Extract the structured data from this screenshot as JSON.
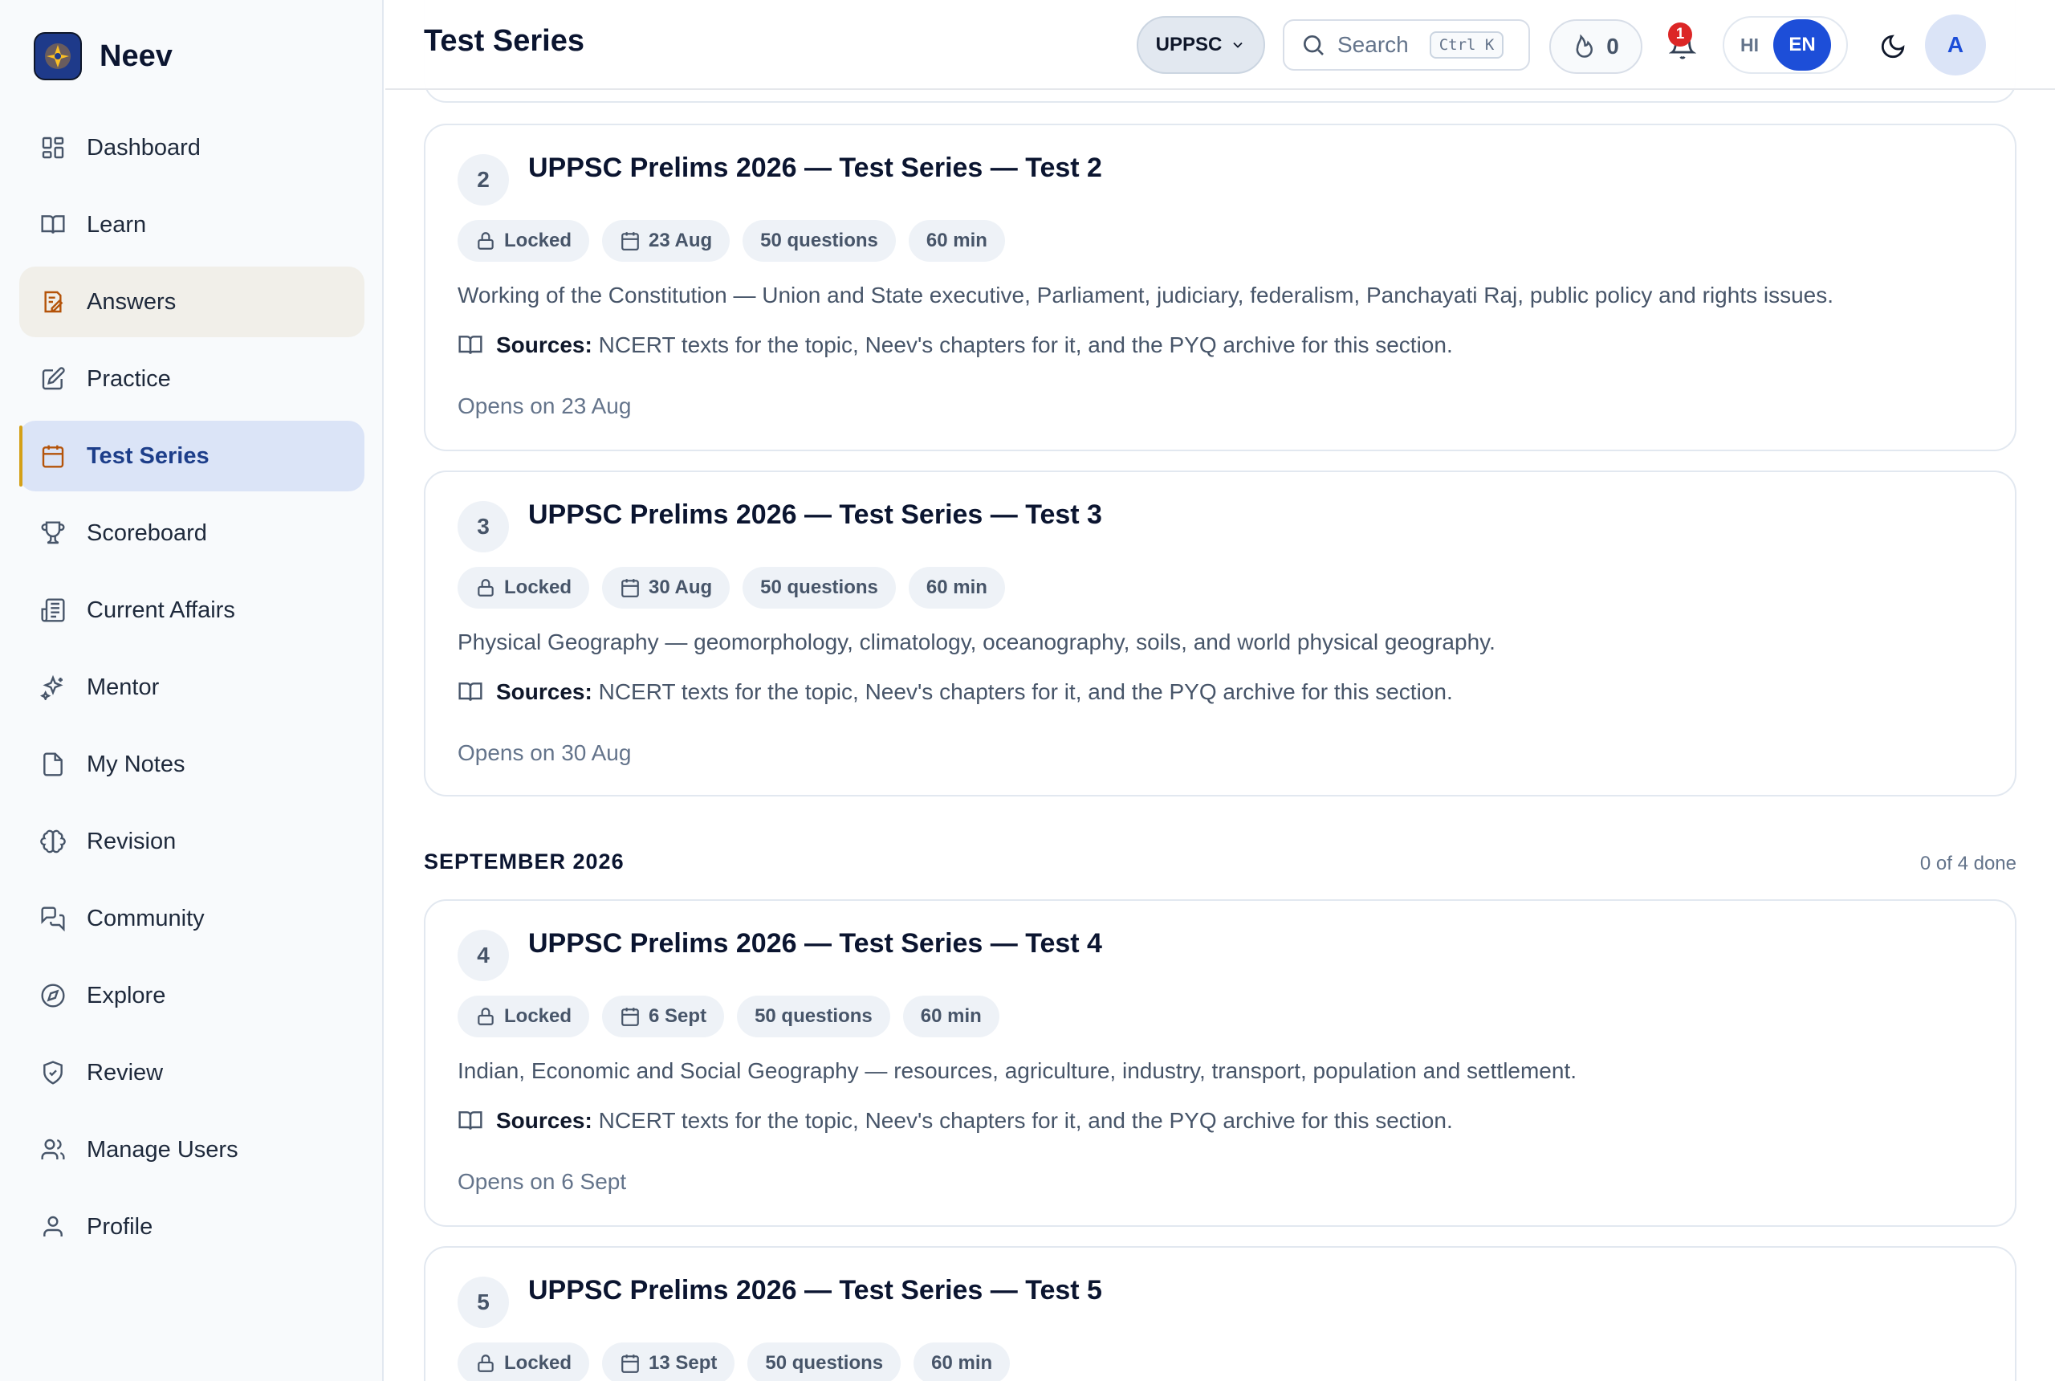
{
  "brand": {
    "name": "Neev"
  },
  "sidebar": {
    "items": [
      {
        "label": "Dashboard",
        "icon": "dashboard-icon"
      },
      {
        "label": "Learn",
        "icon": "book-icon"
      },
      {
        "label": "Answers",
        "icon": "answers-icon"
      },
      {
        "label": "Practice",
        "icon": "pencil-square-icon"
      },
      {
        "label": "Test Series",
        "icon": "calendar-icon"
      },
      {
        "label": "Scoreboard",
        "icon": "trophy-icon"
      },
      {
        "label": "Current Affairs",
        "icon": "newspaper-icon"
      },
      {
        "label": "Mentor",
        "icon": "sparkles-icon"
      },
      {
        "label": "My Notes",
        "icon": "file-icon"
      },
      {
        "label": "Revision",
        "icon": "brain-icon"
      },
      {
        "label": "Community",
        "icon": "chat-icon"
      },
      {
        "label": "Explore",
        "icon": "compass-icon"
      },
      {
        "label": "Review",
        "icon": "shield-icon"
      },
      {
        "label": "Manage Users",
        "icon": "users-icon"
      },
      {
        "label": "Profile",
        "icon": "user-icon"
      }
    ]
  },
  "header": {
    "title": "Test Series",
    "exam": "UPPSC",
    "search_placeholder": "Search",
    "search_shortcut": "Ctrl K",
    "streak": "0",
    "notifications": "1",
    "lang_hi": "HI",
    "lang_en": "EN",
    "avatar_initial": "A"
  },
  "colors": {
    "accent": "#1d4ed8",
    "active_nav_bg": "#dbe4f7",
    "active_marker": "#d4a017",
    "notify": "#dc2626"
  },
  "tests": [
    {
      "number": "2",
      "title": "UPPSC Prelims 2026 — Test Series — Test 2",
      "status": "Locked",
      "date": "23 Aug",
      "questions": "50 questions",
      "duration": "60 min",
      "description": "Working of the Constitution — Union and State executive, Parliament, judiciary, federalism, Panchayati Raj, public policy and rights issues.",
      "sources_label": "Sources:",
      "sources": "NCERT texts for the topic, Neev's chapters for it, and the PYQ archive for this section.",
      "opens": "Opens on 23 Aug"
    },
    {
      "number": "3",
      "title": "UPPSC Prelims 2026 — Test Series — Test 3",
      "status": "Locked",
      "date": "30 Aug",
      "questions": "50 questions",
      "duration": "60 min",
      "description": "Physical Geography — geomorphology, climatology, oceanography, soils, and world physical geography.",
      "sources_label": "Sources:",
      "sources": "NCERT texts for the topic, Neev's chapters for it, and the PYQ archive for this section.",
      "opens": "Opens on 30 Aug"
    },
    {
      "number": "4",
      "title": "UPPSC Prelims 2026 — Test Series — Test 4",
      "status": "Locked",
      "date": "6 Sept",
      "questions": "50 questions",
      "duration": "60 min",
      "description": "Indian, Economic and Social Geography — resources, agriculture, industry, transport, population and settlement.",
      "sources_label": "Sources:",
      "sources": "NCERT texts for the topic, Neev's chapters for it, and the PYQ archive for this section.",
      "opens": "Opens on 6 Sept"
    },
    {
      "number": "5",
      "title": "UPPSC Prelims 2026 — Test Series — Test 5",
      "status": "Locked",
      "date": "13 Sept",
      "questions": "50 questions",
      "duration": "60 min"
    }
  ],
  "month_section": {
    "label": "SEPTEMBER 2026",
    "progress": "0 of 4 done"
  }
}
